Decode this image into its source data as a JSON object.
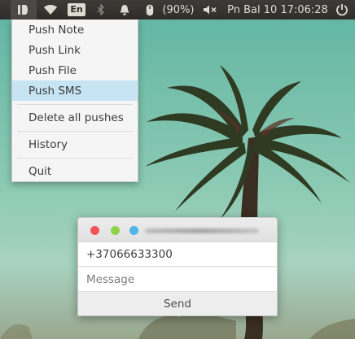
{
  "topbar": {
    "app_indicator_icon": "pushbullet-icon",
    "wifi_icon": "wifi-icon",
    "keyboard_layout": "En",
    "bluetooth_icon": "bluetooth-icon",
    "notification_icon": "bell-icon",
    "mouse_icon": "mouse-icon",
    "battery_percent": "(90%)",
    "volume_icon": "volume-muted-icon",
    "datetime": "Pn Bal 10 17:06:28",
    "power_icon": "power-icon"
  },
  "menu": {
    "items": [
      {
        "label": "Push Note"
      },
      {
        "label": "Push Link"
      },
      {
        "label": "Push File"
      },
      {
        "label": "Push SMS",
        "highlighted": true
      },
      {
        "label": "Delete all pushes"
      },
      {
        "label": "History"
      },
      {
        "label": "Quit"
      }
    ]
  },
  "sms_dialog": {
    "close_color": "#f2545b",
    "minimize_color": "#8fd24b",
    "maximize_color": "#4fb5e6",
    "phone_value": "+37066633300",
    "message_placeholder": "Message",
    "send_label": "Send"
  }
}
